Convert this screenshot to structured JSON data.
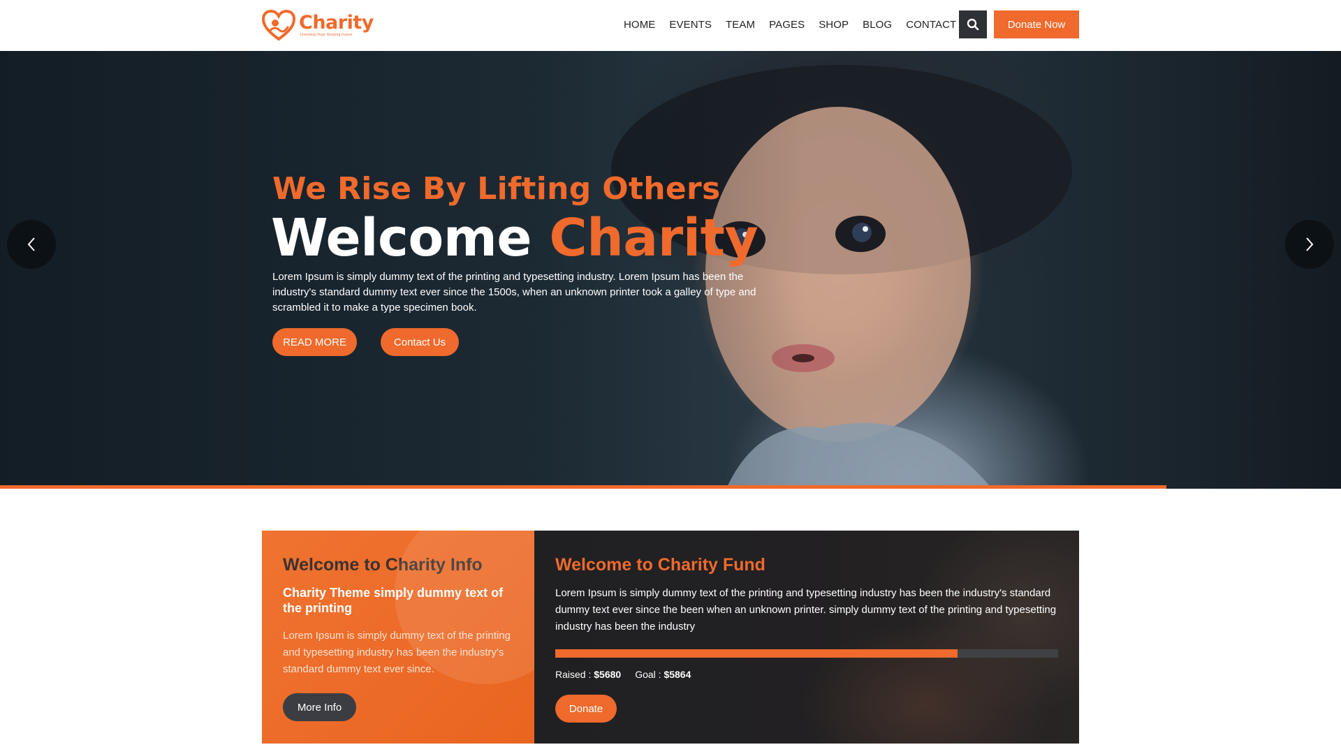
{
  "brand": {
    "name": "Charity",
    "tagline": "Investing Hope Shaping Future",
    "accent_color": "#ef6a2c",
    "dark_color": "#2e3136"
  },
  "nav": {
    "items": [
      "HOME",
      "EVENTS",
      "TEAM",
      "PAGES",
      "SHOP",
      "BLOG",
      "CONTACT US"
    ],
    "search_icon": "search-icon",
    "donate_label": "Donate Now"
  },
  "hero": {
    "tagline": "We Rise By Lifting Others",
    "title_white": "Welcome",
    "title_orange": "Charity",
    "description": "Lorem Ipsum is simply dummy text of the printing and typesetting industry. Lorem Ipsum has been the industry's standard dummy text ever since the 1500s, when an unknown printer took a galley of type and scrambled it to make a type specimen book.",
    "read_more_label": "READ MORE",
    "contact_label": "Contact Us",
    "prev_icon": "chevron-left-icon",
    "next_icon": "chevron-right-icon",
    "slide_progress": 0.87
  },
  "info": {
    "title": "Welcome to Charity Info",
    "subtitle": "Charity Theme simply dummy text of the printing",
    "description": "Lorem Ipsum is simply dummy text of the printing and typesetting industry has been the industry's standard dummy text ever since.",
    "button_label": "More Info"
  },
  "fund": {
    "title": "Welcome to Charity Fund",
    "description": "Lorem Ipsum is simply dummy text of the printing and typesetting industry has been the industry's standard dummy text ever since the been when an unknown printer. simply dummy text of the printing and typesetting industry has been the industry",
    "progress": 0.8,
    "raised_label": "Raised :",
    "raised_value": "$5680",
    "goal_label": "Goal :",
    "goal_value": "$5864",
    "button_label": "Donate"
  }
}
